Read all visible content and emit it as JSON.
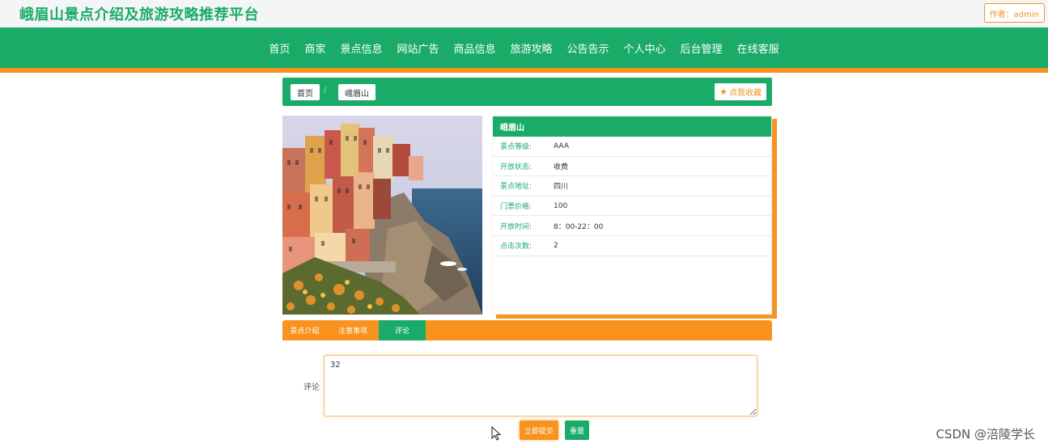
{
  "header": {
    "site_title": "峨眉山景点介绍及旅游攻略推荐平台",
    "author_label": "作者：admin"
  },
  "nav": {
    "items": [
      "首页",
      "商家",
      "景点信息",
      "网站广告",
      "商品信息",
      "旅游攻略",
      "公告告示",
      "个人中心",
      "后台管理",
      "在线客服"
    ]
  },
  "breadcrumb": {
    "home": "首页",
    "separator": "/",
    "current": "峨眉山",
    "favorite_label": "点我收藏",
    "favorite_icon": "star-icon"
  },
  "attraction": {
    "name": "峨眉山",
    "rows": [
      {
        "label": "景点等级:",
        "value": "AAA"
      },
      {
        "label": "开放状态:",
        "value": "收费"
      },
      {
        "label": "景点地址:",
        "value": "四川"
      },
      {
        "label": "门票价格:",
        "value": "100"
      },
      {
        "label": "开放时间:",
        "value": "8：00-22：00"
      },
      {
        "label": "点击次数:",
        "value": "2"
      }
    ]
  },
  "tabs": {
    "items": [
      "景点介绍",
      "注意事项",
      "评论"
    ],
    "active": "评论"
  },
  "comment_form": {
    "label": "评论",
    "value": "32",
    "submit_label": "立即提交",
    "reset_label": "重置"
  },
  "watermark": "CSDN @涪陵学长",
  "colors": {
    "primary_green": "#1aab68",
    "accent_orange": "#f7931e"
  }
}
